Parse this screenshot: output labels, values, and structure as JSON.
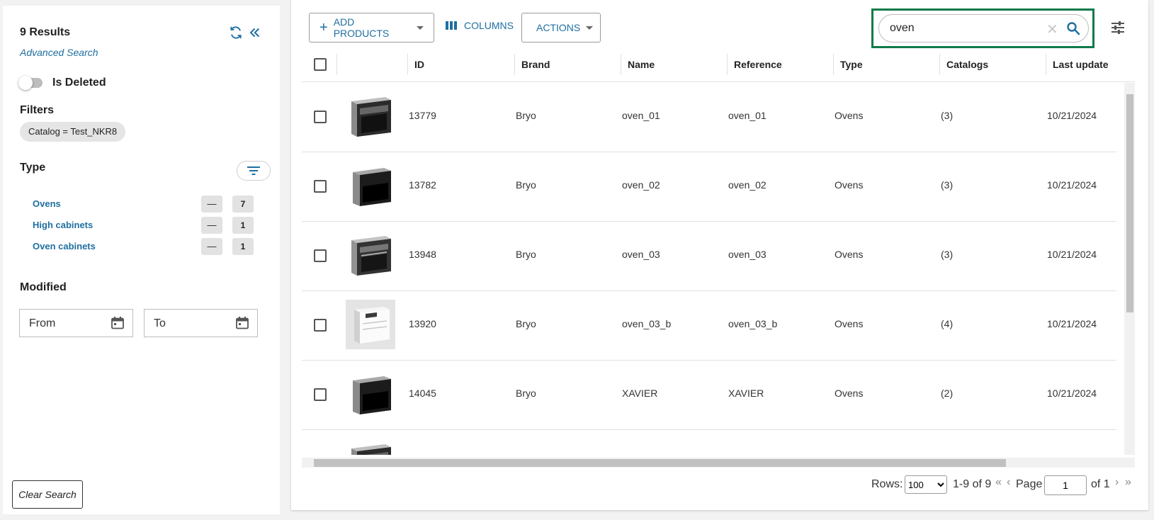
{
  "sidebar": {
    "results_title": "9 Results",
    "advanced_search": "Advanced Search",
    "is_deleted_label": "Is Deleted",
    "filters_title": "Filters",
    "filter_chip": "Catalog = Test_NKR8",
    "type_title": "Type",
    "type_items": [
      {
        "label": "Ovens",
        "minus": "—",
        "count": "7"
      },
      {
        "label": "High cabinets",
        "minus": "—",
        "count": "1"
      },
      {
        "label": "Oven cabinets",
        "minus": "—",
        "count": "1"
      }
    ],
    "modified_title": "Modified",
    "from_placeholder": "From",
    "to_placeholder": "To",
    "clear_search": "Clear Search"
  },
  "toolbar": {
    "add_products": "ADD PRODUCTS",
    "columns": "COLUMNS",
    "actions": "ACTIONS",
    "search_value": "oven"
  },
  "table": {
    "columns": [
      "ID",
      "Brand",
      "Name",
      "Reference",
      "Type",
      "Catalogs",
      "Last update"
    ],
    "rows": [
      {
        "id": "13779",
        "brand": "Bryo",
        "name": "oven_01",
        "reference": "oven_01",
        "type": "Ovens",
        "catalogs": "(3)",
        "last_update": "10/21/2024"
      },
      {
        "id": "13782",
        "brand": "Bryo",
        "name": "oven_02",
        "reference": "oven_02",
        "type": "Ovens",
        "catalogs": "(3)",
        "last_update": "10/21/2024"
      },
      {
        "id": "13948",
        "brand": "Bryo",
        "name": "oven_03",
        "reference": "oven_03",
        "type": "Ovens",
        "catalogs": "(3)",
        "last_update": "10/21/2024"
      },
      {
        "id": "13920",
        "brand": "Bryo",
        "name": "oven_03_b",
        "reference": "oven_03_b",
        "type": "Ovens",
        "catalogs": "(4)",
        "last_update": "10/21/2024"
      },
      {
        "id": "14045",
        "brand": "Bryo",
        "name": "XAVIER",
        "reference": "XAVIER",
        "type": "Ovens",
        "catalogs": "(2)",
        "last_update": "10/21/2024"
      }
    ]
  },
  "pagination": {
    "rows_label": "Rows:",
    "rows_value": "100",
    "range": "1-9 of 9",
    "page_label": "Page",
    "page_value": "1",
    "of_label": "of 1"
  },
  "colors": {
    "accent": "#1f6fa1",
    "search_highlight": "#0e7a4b"
  }
}
